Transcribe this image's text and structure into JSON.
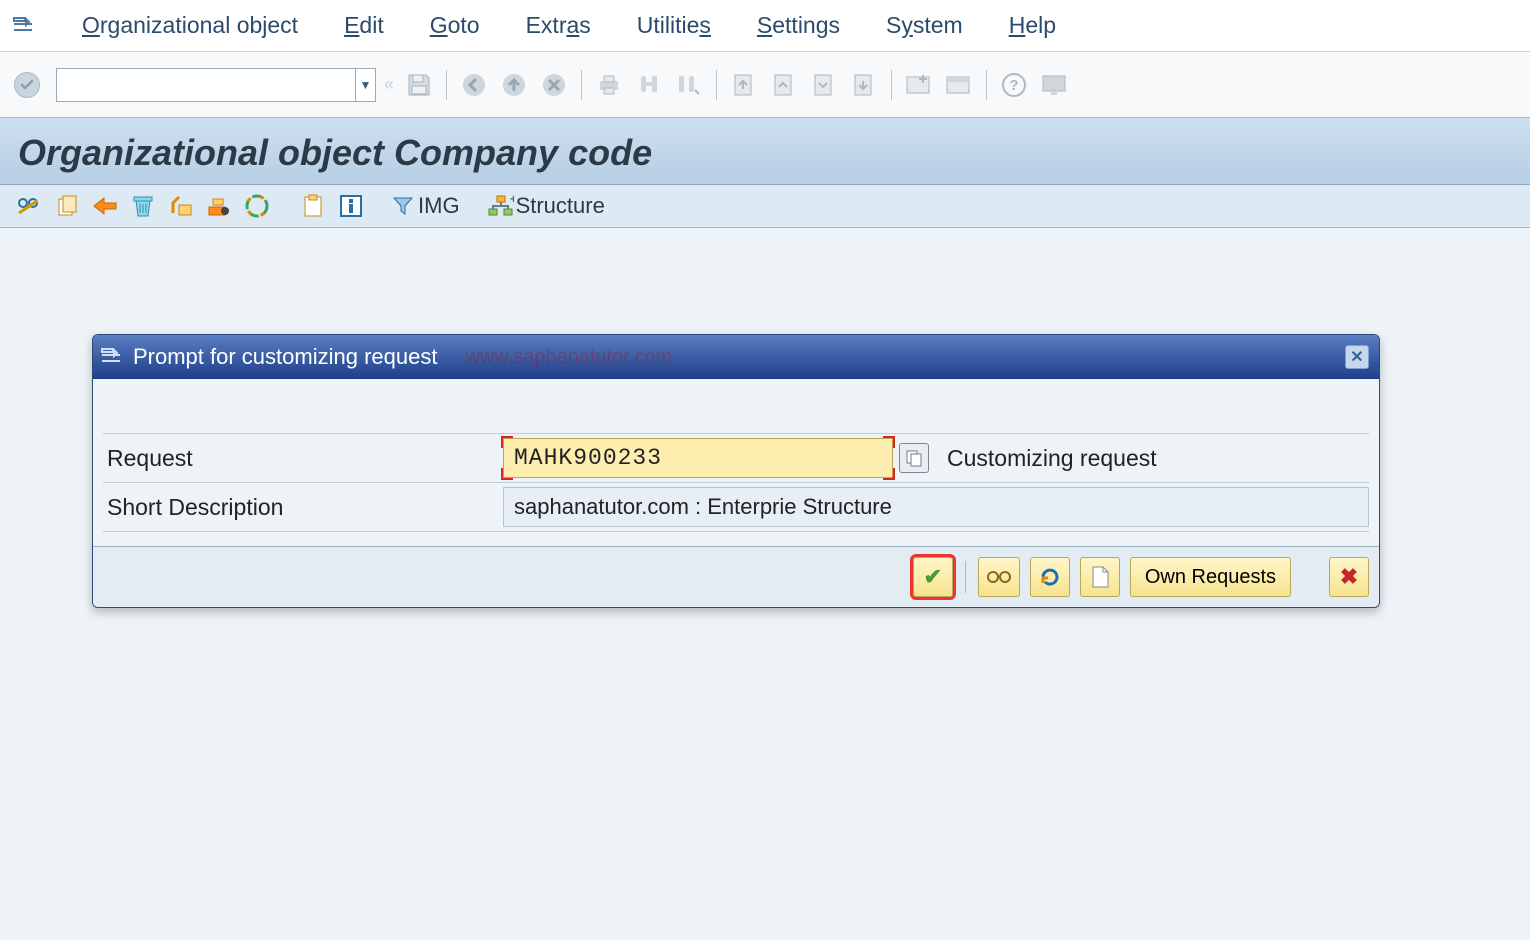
{
  "menu": {
    "items": [
      "Organizational object",
      "Edit",
      "Goto",
      "Extras",
      "Utilities",
      "Settings",
      "System",
      "Help"
    ],
    "underline_idx": [
      0,
      0,
      0,
      4,
      8,
      0,
      1,
      0
    ]
  },
  "command_field": {
    "value": ""
  },
  "page_title": "Organizational object Company code",
  "app_toolbar": {
    "img_label": "IMG",
    "structure_label": "Structure"
  },
  "dialog": {
    "title": "Prompt for customizing request",
    "watermark": "www.saphanatutor.com",
    "fields": {
      "request_label": "Request",
      "request_value": "MAHK900233",
      "request_post_label": "Customizing request",
      "desc_label": "Short Description",
      "desc_value": "saphanatutor.com : Enterprie Structure"
    },
    "buttons": {
      "own_requests": "Own Requests"
    }
  }
}
